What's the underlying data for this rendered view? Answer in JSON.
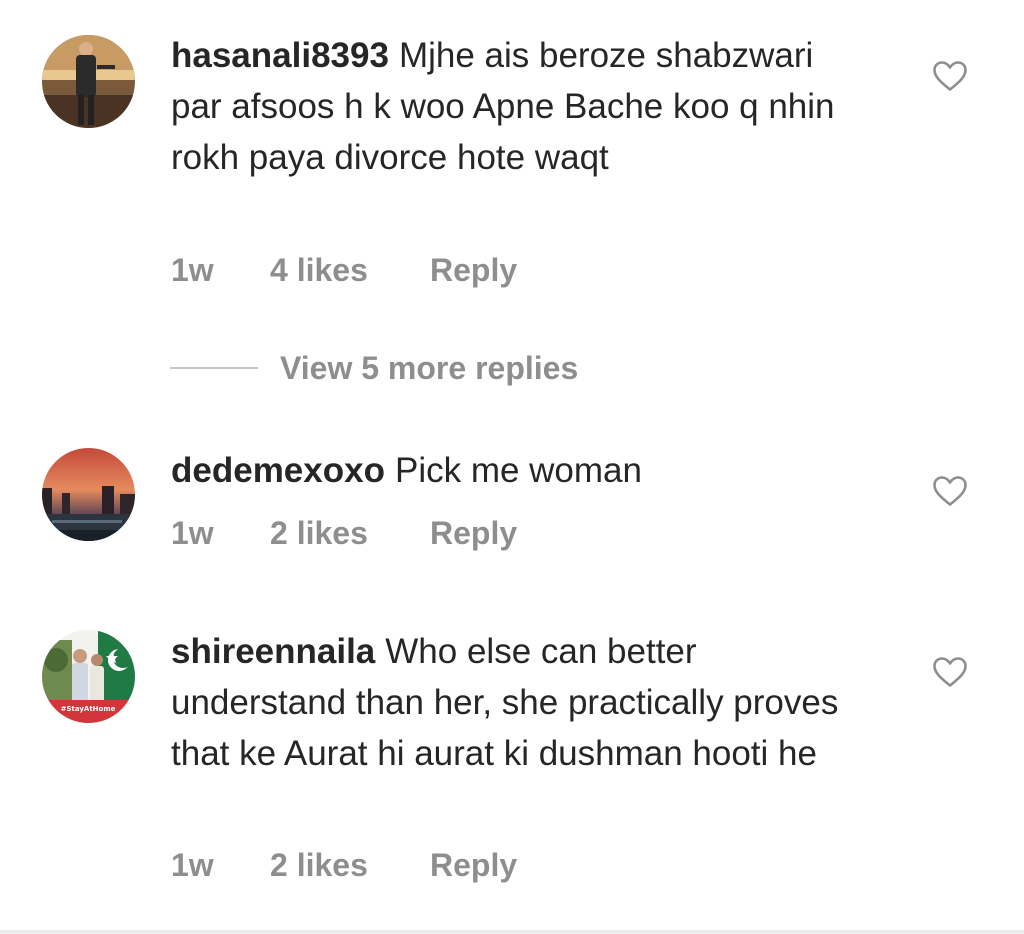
{
  "comments": [
    {
      "username": "hasanali8393",
      "text": "Mjhe ais beroze shabzwari par afsoos h k woo Apne Bache koo q nhin rokh paya divorce hote waqt",
      "time": "1w",
      "likes": "4 likes",
      "reply": "Reply"
    },
    {
      "username": "dedemexoxo",
      "text": "Pick me woman",
      "time": "1w",
      "likes": "2 likes",
      "reply": "Reply"
    },
    {
      "username": "shireennaila",
      "text": "Who else can better understand than her, she practically proves that ke  Aurat hi aurat ki dushman hooti he",
      "time": "1w",
      "likes": "2 likes",
      "reply": "Reply",
      "avatar_caption": "#StayAtHome"
    }
  ],
  "view_more": "View 5 more replies",
  "icons": {
    "like": "heart-outline-icon"
  },
  "colors": {
    "text": "#262626",
    "muted": "#8e8e8e",
    "background": "#ffffff"
  }
}
